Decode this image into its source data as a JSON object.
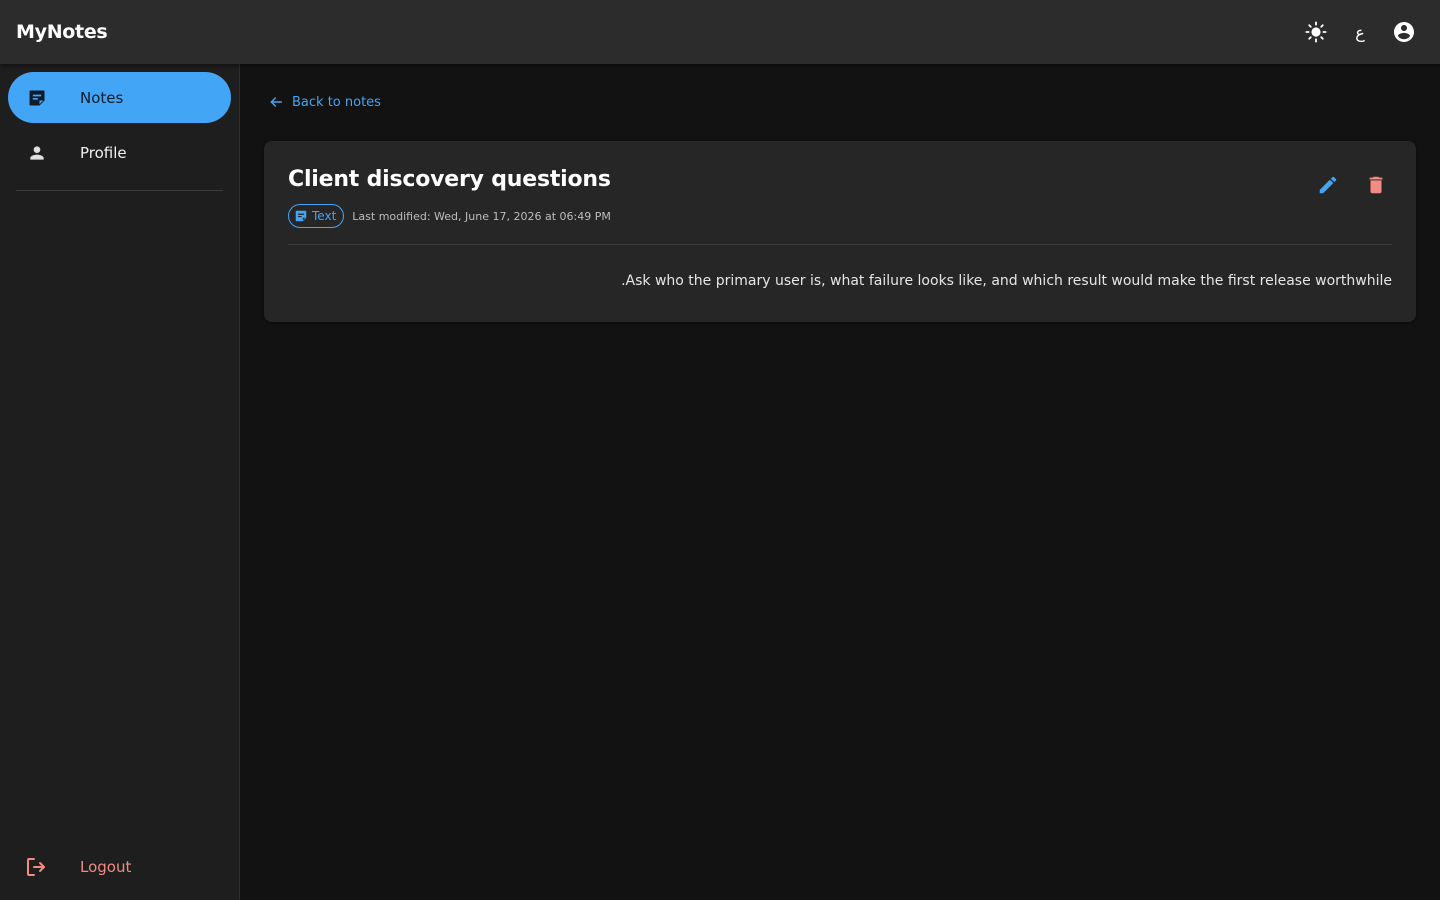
{
  "app": {
    "brand": "MyNotes",
    "language_glyph": "ع"
  },
  "icons": {
    "theme": "sun-icon",
    "language": "language-glyph",
    "account": "account-circle-icon",
    "notes": "sticky-note-icon",
    "profile": "person-icon",
    "logout": "logout-icon",
    "back": "arrow-left-icon",
    "edit": "pencil-icon",
    "delete": "trash-icon",
    "note_type": "sticky-note-icon"
  },
  "sidebar": {
    "items": [
      {
        "label": "Notes",
        "active": true
      },
      {
        "label": "Profile",
        "active": false
      }
    ],
    "logout_label": "Logout"
  },
  "main": {
    "back_label": "Back to notes",
    "note": {
      "title": "Client discovery questions",
      "type_label": "Text",
      "modified": "Last modified: Wed, June 17, 2026 at 06:49 PM",
      "body": ".Ask who the primary user is, what failure looks like, and which result would make the first release worthwhile"
    }
  },
  "colors": {
    "accent": "#42a5f5",
    "danger": "#f28b82",
    "appbar": "#2c2c2c",
    "sidebar": "#1e1e1e",
    "background": "#121212",
    "card": "#262626"
  }
}
